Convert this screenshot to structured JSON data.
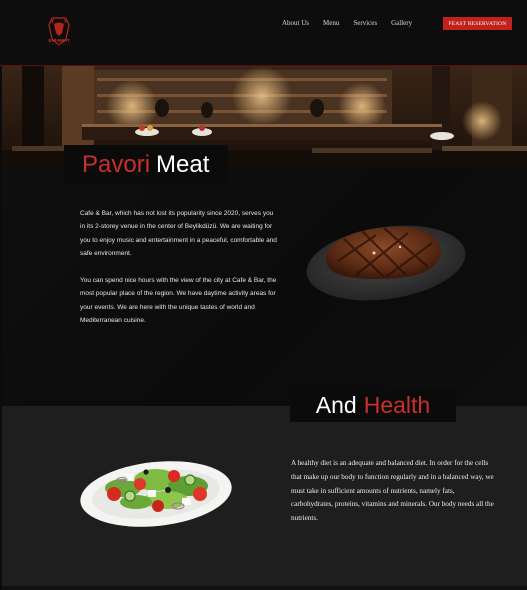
{
  "brand": {
    "logo_text": "EAT•MEAT",
    "logo_icon": "bull-shield-icon"
  },
  "nav": {
    "items": [
      "About Us",
      "Menu",
      "Services",
      "Gallery"
    ],
    "cta": "FEAST RESERVATION"
  },
  "section1": {
    "title_red": "Pavori",
    "title_white": "Meat",
    "paragraph1": "Cafe & Bar, which has not lost its popularity since 2020, serves you in its 2-storey venue in the center of Beylikdüzü. We are waiting for you to enjoy music and entertainment in a peaceful, comfortable and safe environment.",
    "paragraph2": "You can spend nice hours with the view of the city at Cafe & Bar, the most popular place of the region. We have daytime activity areas for your events. We are here with the unique tastes of world and Mediterranean cuisine."
  },
  "section2": {
    "title_white": "And",
    "title_red": "Health",
    "paragraph": "A healthy diet is an adequate and balanced diet. In order for the cells that make up our body to function regularly and in a balanced way, we must take in sufficient amounts of nutrients, namely fats, carbohydrates, proteins, vitamins and minerals. Our body needs all the nutrients."
  },
  "colors": {
    "accent": "#c9302c",
    "button": "#c0221c",
    "bg": "#0b0b0b",
    "band": "#1e1e1e"
  }
}
